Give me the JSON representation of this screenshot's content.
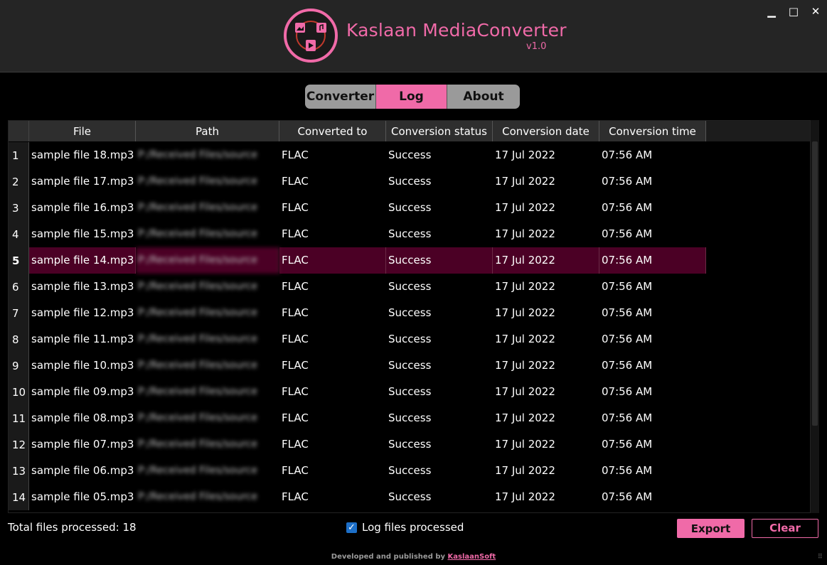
{
  "app": {
    "title": "Kaslaan MediaConverter",
    "version": "v1.0"
  },
  "window": {
    "minimize": "▁",
    "maximize": "□",
    "close": "✕"
  },
  "tabs": [
    {
      "label": "Converter",
      "active": false
    },
    {
      "label": "Log",
      "active": true
    },
    {
      "label": "About",
      "active": false
    }
  ],
  "table": {
    "columns": [
      "File",
      "Path",
      "Converted to",
      "Conversion status",
      "Conversion date",
      "Conversion time"
    ],
    "selected_row": 5,
    "rows": [
      {
        "n": "1",
        "file": "sample file 18.mp3",
        "path": "P:/Received Files/source",
        "to": "FLAC",
        "status": "Success",
        "date": "17 Jul 2022",
        "time": "07:56 AM"
      },
      {
        "n": "2",
        "file": "sample file 17.mp3",
        "path": "P:/Received Files/source",
        "to": "FLAC",
        "status": "Success",
        "date": "17 Jul 2022",
        "time": "07:56 AM"
      },
      {
        "n": "3",
        "file": "sample file 16.mp3",
        "path": "P:/Received Files/source",
        "to": "FLAC",
        "status": "Success",
        "date": "17 Jul 2022",
        "time": "07:56 AM"
      },
      {
        "n": "4",
        "file": "sample file 15.mp3",
        "path": "P:/Received Files/source",
        "to": "FLAC",
        "status": "Success",
        "date": "17 Jul 2022",
        "time": "07:56 AM"
      },
      {
        "n": "5",
        "file": "sample file 14.mp3",
        "path": "P:/Received Files/source",
        "to": "FLAC",
        "status": "Success",
        "date": "17 Jul 2022",
        "time": "07:56 AM"
      },
      {
        "n": "6",
        "file": "sample file 13.mp3",
        "path": "P:/Received Files/source",
        "to": "FLAC",
        "status": "Success",
        "date": "17 Jul 2022",
        "time": "07:56 AM"
      },
      {
        "n": "7",
        "file": "sample file 12.mp3",
        "path": "P:/Received Files/source",
        "to": "FLAC",
        "status": "Success",
        "date": "17 Jul 2022",
        "time": "07:56 AM"
      },
      {
        "n": "8",
        "file": "sample file 11.mp3",
        "path": "P:/Received Files/source",
        "to": "FLAC",
        "status": "Success",
        "date": "17 Jul 2022",
        "time": "07:56 AM"
      },
      {
        "n": "9",
        "file": "sample file 10.mp3",
        "path": "P:/Received Files/source",
        "to": "FLAC",
        "status": "Success",
        "date": "17 Jul 2022",
        "time": "07:56 AM"
      },
      {
        "n": "10",
        "file": "sample file 09.mp3",
        "path": "P:/Received Files/source",
        "to": "FLAC",
        "status": "Success",
        "date": "17 Jul 2022",
        "time": "07:56 AM"
      },
      {
        "n": "11",
        "file": "sample file 08.mp3",
        "path": "P:/Received Files/source",
        "to": "FLAC",
        "status": "Success",
        "date": "17 Jul 2022",
        "time": "07:56 AM"
      },
      {
        "n": "12",
        "file": "sample file 07.mp3",
        "path": "P:/Received Files/source",
        "to": "FLAC",
        "status": "Success",
        "date": "17 Jul 2022",
        "time": "07:56 AM"
      },
      {
        "n": "13",
        "file": "sample file 06.mp3",
        "path": "P:/Received Files/source",
        "to": "FLAC",
        "status": "Success",
        "date": "17 Jul 2022",
        "time": "07:56 AM"
      },
      {
        "n": "14",
        "file": "sample file 05.mp3",
        "path": "P:/Received Files/source",
        "to": "FLAC",
        "status": "Success",
        "date": "17 Jul 2022",
        "time": "07:56 AM"
      }
    ]
  },
  "footer_bar": {
    "total_label": "Total files processed:",
    "total_count": "18",
    "log_checkbox_label": "Log files processed",
    "log_checked": true,
    "export_label": "Export",
    "clear_label": "Clear"
  },
  "credit": {
    "prefix": "Developed and published by",
    "link": "KaslaanSoft"
  },
  "colors": {
    "accent": "#f06aa8",
    "selected_row": "#4b0025",
    "titlebar": "#252525",
    "checkbox": "#1d6fc8"
  }
}
